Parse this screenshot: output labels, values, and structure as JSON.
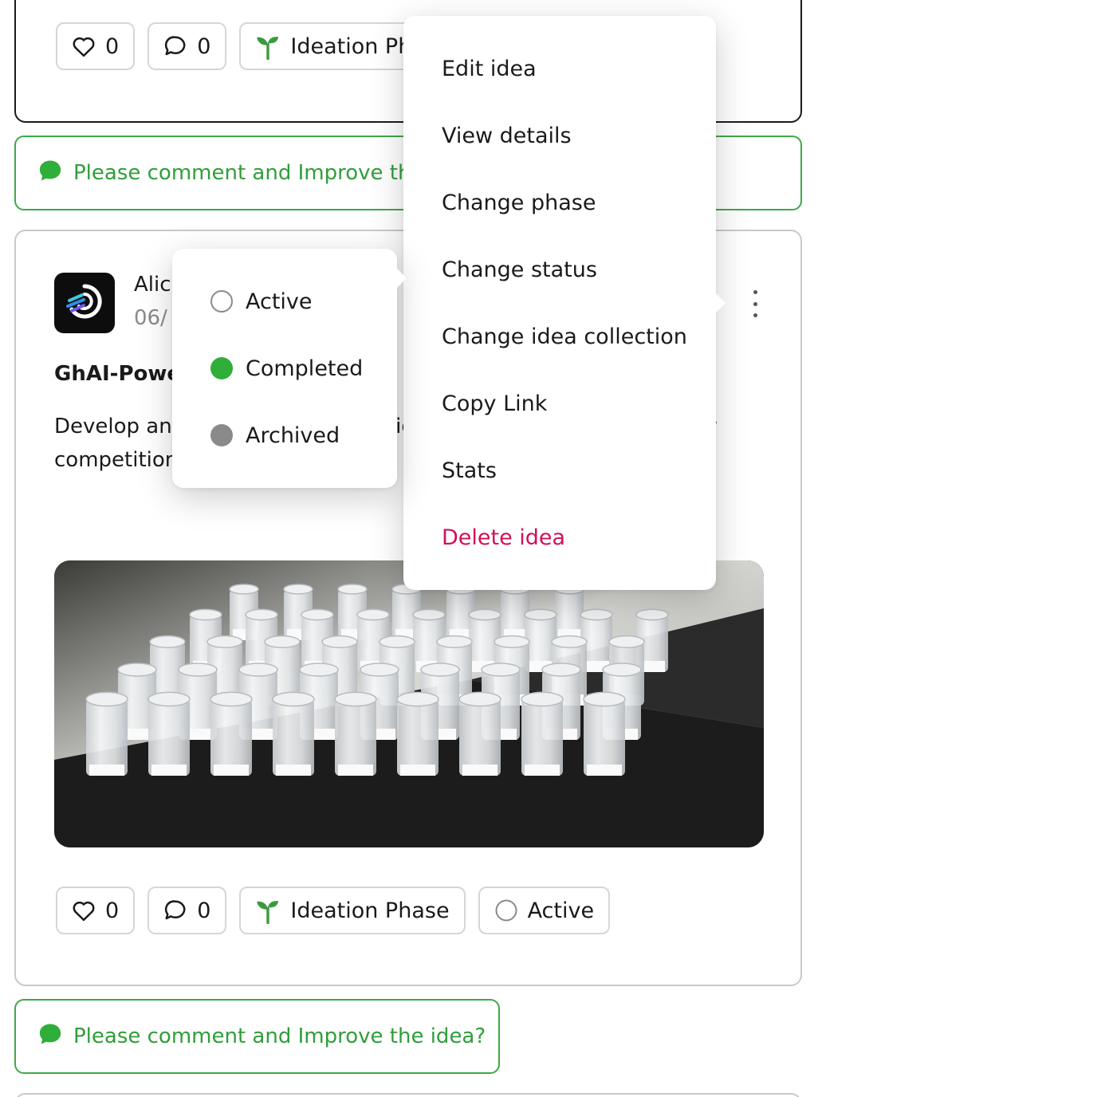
{
  "top_card": {
    "likes": "0",
    "comments": "0",
    "phase_label": "Ideation Ph"
  },
  "prompt_top": {
    "text": "Please comment and Improve th"
  },
  "idea": {
    "author": "Alic",
    "date": "06/",
    "title": "GhAI-Powe",
    "description": "Develop an                                   a predict eme                                      s                                                                           e insights into market shifts, allowir competition.",
    "likes": "0",
    "comments": "0",
    "phase_label": "Ideation Phase",
    "status_label": "Active"
  },
  "prompt_bottom": {
    "text": "Please comment and Improve the idea?"
  },
  "action_menu": {
    "items": [
      {
        "label": "Edit idea"
      },
      {
        "label": "View details"
      },
      {
        "label": "Change phase"
      },
      {
        "label": "Change status"
      },
      {
        "label": "Change idea collection"
      },
      {
        "label": "Copy Link"
      },
      {
        "label": "Stats"
      },
      {
        "label": "Delete idea"
      }
    ]
  },
  "status_menu": {
    "items": [
      {
        "label": "Active",
        "state": "empty"
      },
      {
        "label": "Completed",
        "state": "selected",
        "color": "#2fae3a"
      },
      {
        "label": "Archived",
        "state": "gray",
        "color": "#8a8a8a"
      }
    ]
  },
  "colors": {
    "accent_green": "#2f9e3a",
    "danger": "#d0105a"
  }
}
